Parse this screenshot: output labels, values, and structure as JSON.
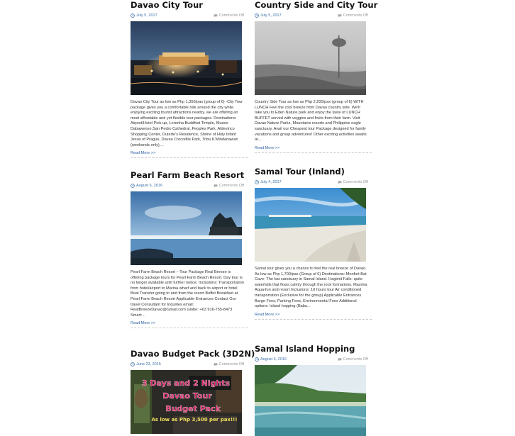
{
  "posts": [
    {
      "title": "Davao City Tour",
      "date": "July 5, 2017",
      "comments": "Comments Off",
      "excerpt": "Davao City Tour as low as Php 1,350/pax (group of 6) -City Tour package gives you a comfortable ride around the city while enjoying exciting tourist attractions nearby. we are offering an most affordable and yet flexible tour packages. Destinations: Airport/Hotel Pick-up, Lorenha Buddhist Temple, Museo Dabawenyo,San Pedro Cathedral, Peoples Park, Aldevinco Shopping Center, Duterte's Residence, Shrine of Holy Infant Jesus of Prague, Davao Crocodile Park, Tribu K'Mindanawan (weekends only),...",
      "read_more": "Read More >>"
    },
    {
      "title": "Country Side and City Tour",
      "date": "July 5, 2017",
      "comments": "Comments Off",
      "excerpt": "Country Side Tour as low as Php 2,200/pax (group of 6) WITH LUNCH Feel the cool breeze from Davao country side. We'll take you to Eden Nature park and enjoy the taste of LUNCH BUFFET served with veggies and fruits from their farm. Visit Davao Nature Parks, Mountains resorts and Philippine eagle sanctuary. Avail our Cheapest tour Package designed for family vacations and group adventures! Other exciting activities awaits at....",
      "read_more": "Read More >>"
    },
    {
      "title": "Pearl Farm Beach Resort",
      "date": "August 6, 2016",
      "comments": "Comments Off",
      "excerpt": "Pearl Farm Beach Resort – Tour Package Real Breeze is offering package tours for Pearl Farm Beach Resort. Day tour is no longer available until further notice. Inclusions: Transportation from hotel/airport to Marina wharf and back to airport or hotel Boat Transfer going to and from the resort Buffet Breakfast at Pearl Farm Beach Resort Applicable Entrances  Contact Our travel Consultant for Inquiries email: RealBreezeDavao@Gmail.com Globe: +63 916-755-8473 Smart:...",
      "read_more": "Read More >>"
    },
    {
      "title": "Samal Tour (Inland)",
      "date": "July 4, 2017",
      "comments": "Comments Off",
      "excerpt": "Samal tour gives you a chance to feel the real breeze of Davao. As low as Php 1,700/pax (Group of 6) Destinations: Monfort Bat Cave- The bat sanctuary in Samal Island. Hagimit Falls- quite waterfalls that flows calmly through the rock formations. Maxima Aqua-fun and resort Inclusions: 10 hours tour Air conditioned transportation (Exclusive for the group) Applicable Entrances Barge Fees, Parking Fees, Environmental Fees Additional options: Island hopping (Babu...",
      "read_more": "Read More >>"
    },
    {
      "title": "Davao Budget Pack (3D2N)",
      "date": "June 23, 2015",
      "comments": "Comments Off",
      "image_text": {
        "line1": "3 Days and 2 Nights",
        "line2": "Davao Tour",
        "line3": "Budget Pack",
        "line4": "As low as Php 3,500 per pax!!!"
      }
    },
    {
      "title": "Samal Island Hopping",
      "date": "August 6, 2016",
      "comments": "Comments Off"
    }
  ],
  "colors": {
    "link": "#2b5fa3",
    "meta": "#3a6fa8",
    "promo_text": "#e0206a"
  },
  "icons": [
    "clock-icon",
    "comment-icon"
  ]
}
